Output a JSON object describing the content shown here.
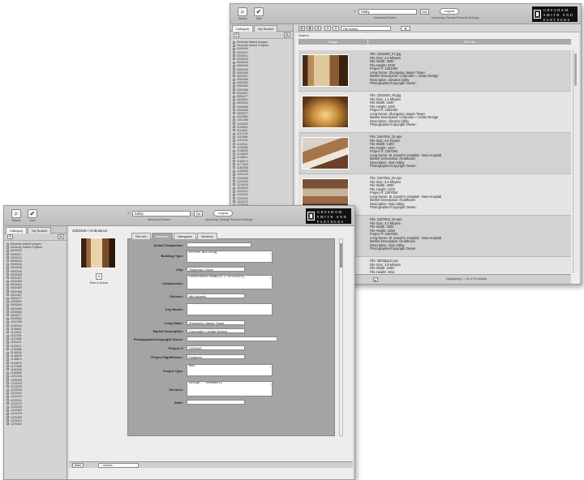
{
  "toolbar": {
    "search_label": "Search",
    "cart_label": "Cart",
    "search_value": "lobby",
    "go_label": "Go",
    "logout_label": "Logout",
    "advanced_search": "Advanced Search",
    "preferences": "Upcoming: Change Personal Settings"
  },
  "logo": {
    "line1": "GRESHAM",
    "line2": "SMITH AND",
    "line3": "PARTNERS"
  },
  "sidebar": {
    "tabs": [
      "Category",
      "My Search"
    ],
    "add": "+",
    "sort": "A▸",
    "items": [
      "Recently Added Images",
      "Recently Added Projects",
      "0000004",
      "0000027",
      "0000041",
      "0000043",
      "0000044",
      "0000045",
      "0000049",
      "0000455",
      "0000457",
      "0000460",
      "0000461",
      "0000463",
      "0000466",
      "0000467",
      "0000477",
      "0000501",
      "0000504",
      "0000566",
      "0000569",
      "0000577",
      "0000582",
      "1001398",
      "1102000",
      "1105601",
      "1111904",
      "1112706",
      "1113366",
      "1115115",
      "1115911",
      "1140956",
      "1145530",
      "1148025",
      "1148514",
      "1163074",
      "1177800",
      "1180258",
      "1183580",
      "1201315",
      "1205390",
      "1215794",
      "1219230",
      "1220004",
      "1220031",
      "1220119",
      "1220201",
      "1220270",
      "1220290",
      "1220352",
      "1220378",
      "1220480",
      "1220513",
      "1220542"
    ]
  },
  "back": {
    "view_buttons": [
      "▤",
      "▦",
      "▥",
      "A",
      "A"
    ],
    "sort_field": "File Name",
    "sort_dir": "▼",
    "crumb": "Search",
    "headers": [
      "Image",
      "File Info"
    ],
    "rows": [
      {
        "lines": [
          "File: 2253400_07.jpg",
          "File Size: 4.3 Mbytes",
          "File Width: 3000",
          "File Height: 2238",
          "Project #: 2253400",
          "Long Name: Zhongxing Jasper Tower",
          "Market Description: Corporate + Urban Design",
          "Description: elevator lobby",
          "Photographer/Copyright Owner:"
        ]
      },
      {
        "lines": [
          "File: 2253400_08.jpg",
          "File Size: 1.1 Mbytes",
          "File Width: 1600",
          "File Height: 1200",
          "Project #: 2253400",
          "Long Name: Zhongxing Jasper Tower",
          "Market Description: Corporate + Urban Design",
          "Description: elevator lobby",
          "Photographer/Copyright Owner:"
        ]
      },
      {
        "lines": [
          "File: 2267004_01.eps",
          "File Size: 3.0 Kbytes",
          "File Width: 1400",
          "File Height: 1047",
          "Project #: 2267004",
          "Long Name: St Joseph's Hospital - New Hospital",
          "Market Description: Healthcare",
          "Description: main lobby",
          "Photographer/Copyright Owner:"
        ]
      },
      {
        "lines": [
          "File: 2267004_02.eps",
          "File Size: 2.6 Mbytes",
          "File Width: 3000",
          "File Height: 2103",
          "Project #: 2267004",
          "Long Name: St Joseph's Hospital - New Hospital",
          "Market Description: Healthcare",
          "Description: main lobby",
          "Photographer/Copyright Owner:"
        ]
      },
      {
        "lines": [
          "File: 2267004_03.eps",
          "File Size: 3.3 Mbytes",
          "File Width: 3000",
          "File Height: 2250",
          "Project #: 2267004",
          "Long Name: St Joseph's Hospital - New Hospital",
          "Market Description: Healthcare",
          "Description: main lobby",
          "Photographer/Copyright Owner:"
        ]
      },
      {
        "lines": [
          "File: 0923dg12.eps",
          "File Size: 1.9 Mbytes",
          "File Width: 2400",
          "File Height: 1911",
          "Project #: 2268011"
        ]
      }
    ],
    "page_btn": "▸",
    "status": "Displaying 1 - 13 of 13 results"
  },
  "front": {
    "title": "2253400 / Ambulance",
    "pan_zoom": "Pan & Zoom",
    "tabs": [
      "File Info",
      "Attributes",
      "Categories",
      "Versions"
    ],
    "fields": [
      {
        "label": "Actual Completion:",
        "value": ""
      },
      {
        "label": "Building Type:",
        "value": "Office Building"
      },
      {
        "label": "City:",
        "value": "Shanghai, China"
      },
      {
        "label": "Components:",
        "value": "Conference Room(s) | Office(s)"
      },
      {
        "label": "Division:",
        "value": "Mid-Atlantic"
      },
      {
        "label": "Key Words:",
        "value": ""
      },
      {
        "label": "Long Name:",
        "value": "Zhongxing Jasper Tower"
      },
      {
        "label": "Market Description:",
        "value": "Corporate + Urban Design"
      },
      {
        "label": "Photographer/Copyright Owner:",
        "value": ""
      },
      {
        "label": "Project #:",
        "value": "2253400"
      },
      {
        "label": "Project Significance:",
        "value": "Featured"
      },
      {
        "label": "Project Type:",
        "value": "New"
      },
      {
        "label": "Services:",
        "value": "Design - Schematic"
      },
      {
        "label": "State:",
        "value": ""
      }
    ],
    "save": "Save",
    "actions": "-- Actions --"
  }
}
